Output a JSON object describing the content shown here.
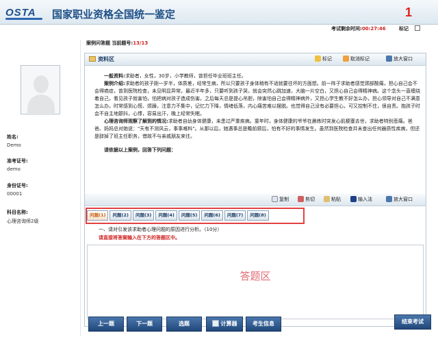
{
  "header": {
    "logo": "OSTA",
    "title": "国家职业资格全国统一鉴定",
    "badge_number": "1"
  },
  "timer": {
    "label": "考试剩余时间:",
    "value": "00:27:46"
  },
  "mark_top": {
    "label": "标记"
  },
  "question_header": {
    "type": "案例问答题",
    "label": "当前题号:",
    "count": "13/13"
  },
  "candidate": {
    "name_label": "姓名:",
    "name": "Demo",
    "admission_label": "准考证号:",
    "admission": "demo",
    "id_label": "身份证号:",
    "id": "00001",
    "subject_label": "科目名称:",
    "subject": "心理咨询师2级"
  },
  "material_bar": {
    "title": "资料区",
    "mark": "标记",
    "unmark": "取消标记",
    "zoom": "放大窗口"
  },
  "case": {
    "general_label": "一般资料:",
    "general": "求助者，女性，30岁，小学教师，曾担任毕业班班主任。",
    "intro_label": "案例介绍:",
    "intro": "求助者的孩子刚一岁半，体质差，经常生病，所以只要孩子身体稍有不适就要往坏的方面想。前一阵子求助者感觉颈部酸痛，担心自己会不会得癌症，曾到医院检查，未见明显异常。最近半年多，只要听到孩子哭，就会突然心跳加速，大脑一片空白，又担心自己会得精神病。这个念头一直缠绕着自己，看见孩子就害怕，怕把病对孩子造成伤害。之后每天总是提心吊胆，除害怕自己会得精神病外，又担心学生教不好怎么办，担心领导对自己不满意怎么办。时常感到心慌、烦躁，注意力不集中，记忆力下降，情绪低落，内心痛苦难以摆脱。也觉得自己没有必要担心，可又控制不住，很自责。抱孩子时会不自主地颤抖，心悸，容易出汗，晚上经常失眠。",
    "observe_label": "心理咨询师观察了解到的情况:",
    "observe": "求助者自幼身体健康，未患过严重疾病。童年时，身体健康的爷爷在晨练时突发心肌梗塞去世，求助者特别悲痛。爸爸、妈妈总对她说：\"天有不测风云，事事难料\"。从那以后，她遇事总是瞻前顾后，怕有不好的事情发生。虽然到医院检查并未查出任何器质性疾病，但还是辞掉了班主任职务，借故不与亲戚朋友来往。",
    "ask": "请依据以上案例，回答下列问题："
  },
  "answer_bar": {
    "copy": "复制",
    "cut": "剪切",
    "paste": "粘贴",
    "ime": "输入法",
    "zoom": "放大窗口"
  },
  "tabs": [
    "问题(1)",
    "问题(2)",
    "问题(3)",
    "问题(4)",
    "问题(5)",
    "问题(6)",
    "问题(7)",
    "问题(8)"
  ],
  "question": {
    "text": "一、请对引发该求助者心理问题的原因进行分析。（10分）",
    "tip": "请直接将答案输入在下方的答题区中。",
    "answer_placeholder": "答题区"
  },
  "nav": {
    "prev": "上一题",
    "next": "下一题",
    "select": "选题",
    "calculator": "计算器",
    "candidate_info": "考生信息",
    "end": "结束考试"
  },
  "colors": {
    "accent": "#21477a",
    "alert": "#d02020",
    "highlight_box": "#e34040"
  }
}
